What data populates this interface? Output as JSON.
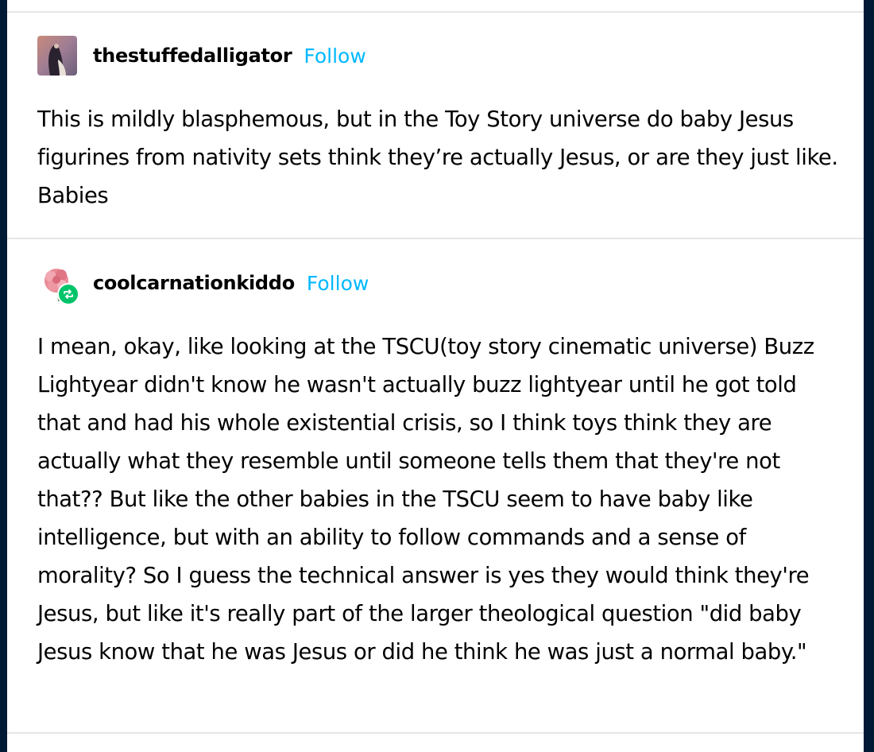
{
  "posts": [
    {
      "username": "thestuffedalligator",
      "follow_label": "Follow",
      "text": "This is mildly blasphemous, but in the Toy Story universe do baby Jesus figurines from nativity sets think they’re actually Jesus, or are they just like. Babies"
    },
    {
      "username": "coolcarnationkiddo",
      "follow_label": "Follow",
      "reblog_icon": "reblog-icon",
      "text": "I mean, okay, like looking at the TSCU(toy story cinematic universe) Buzz Lightyear didn't know he wasn't actually buzz lightyear until he got told that and had his whole existential crisis, so I think toys think they are actually what they resemble until someone tells them that they're not that?? But like the other babies in the TSCU seem to have baby like intelligence, but with an ability to follow commands and a sense of morality? So I guess the technical answer is yes they would think they're Jesus, but like it's really part of the larger theological question \"did baby Jesus know that he was Jesus or did he think he was just a normal baby.\""
    }
  ],
  "colors": {
    "background": "#001935",
    "panel": "#ffffff",
    "follow": "#00b8ff",
    "reblog_badge": "#00c46a",
    "divider": "#e6e6e6"
  }
}
